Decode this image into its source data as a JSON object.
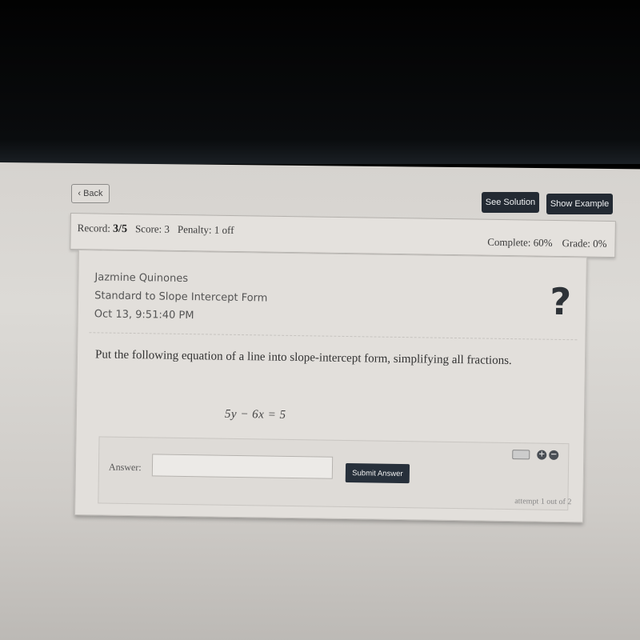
{
  "nav": {
    "back_label": "Back",
    "back_icon": "chevron-left-icon"
  },
  "actions": {
    "see_solution": "See Solution",
    "show_example": "Show Example"
  },
  "status": {
    "record_label": "Record:",
    "record_value": "3/5",
    "score": "Score: 3",
    "penalty": "Penalty: 1 off",
    "complete": "Complete: 60%",
    "grade": "Grade: 0%"
  },
  "problem": {
    "student": "Jazmine Quinones",
    "topic": "Standard to Slope Intercept Form",
    "timestamp": "Oct 13, 9:51:40 PM",
    "help_icon": "?",
    "prompt": "Put the following equation of a line into slope-intercept form, simplifying all fractions.",
    "equation": "5y − 6x = 5"
  },
  "answer": {
    "label": "Answer:",
    "value": "",
    "placeholder": "",
    "submit": "Submit Answer",
    "plus": "+",
    "minus": "−",
    "attempt": "attempt 1 out of 2"
  }
}
